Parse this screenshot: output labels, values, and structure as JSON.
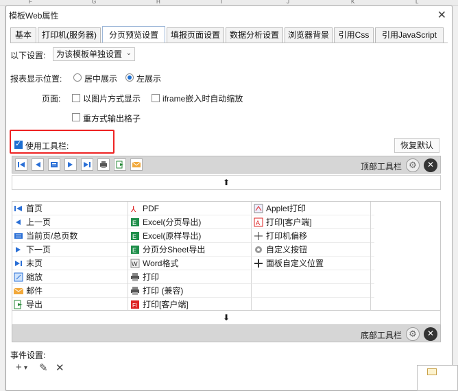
{
  "background": {
    "columns": [
      "F",
      "G",
      "H",
      "I",
      "J",
      "K",
      "L"
    ]
  },
  "dialog": {
    "title": "模板Web属性",
    "close_glyph": "✕"
  },
  "tabs": [
    {
      "label": "基本"
    },
    {
      "label": "打印机(服务器)"
    },
    {
      "label": "分页预览设置",
      "active": true
    },
    {
      "label": "填报页面设置"
    },
    {
      "label": "数据分析设置"
    },
    {
      "label": "浏览器背景"
    },
    {
      "label": "引用Css"
    },
    {
      "label": "引用JavaScript"
    }
  ],
  "settings": {
    "scope_label": "以下设置:",
    "scope_value": "为该模板单独设置",
    "position_label": "报表显示位置:",
    "position_center": "居中展示",
    "position_left": "左展示",
    "position_selected": "left",
    "page_label": "页面:",
    "option_image": "以图片方式显示",
    "option_iframe": "iframe嵌入时自动缩放",
    "option_repeat": "重方式输出格子",
    "use_toolbar_label": "使用工具栏:",
    "use_toolbar_checked": true,
    "restore_default": "恢复默认"
  },
  "toolbars": {
    "top_label": "顶部工具栏",
    "bottom_label": "底部工具栏",
    "up_arrow": "⬆",
    "down_arrow": "⬇",
    "top_icons": [
      "first-page-icon",
      "prev-page-icon",
      "page-count-icon",
      "next-page-icon",
      "last-page-icon",
      "print-icon",
      "export-icon",
      "email-icon"
    ]
  },
  "available_buttons": {
    "col1": [
      {
        "label": "首页",
        "icon": "first-page-icon"
      },
      {
        "label": "上一页",
        "icon": "prev-page-icon"
      },
      {
        "label": "当前页/总页数",
        "icon": "page-count-icon"
      },
      {
        "label": "下一页",
        "icon": "next-page-icon"
      },
      {
        "label": "末页",
        "icon": "last-page-icon"
      },
      {
        "label": "缩放",
        "icon": "zoom-icon"
      },
      {
        "label": "邮件",
        "icon": "email-icon"
      },
      {
        "label": "导出",
        "icon": "export-icon"
      }
    ],
    "col2": [
      {
        "label": "PDF",
        "icon": "pdf-icon"
      },
      {
        "label": "Excel(分页导出)",
        "icon": "excel-icon"
      },
      {
        "label": "Excel(原样导出)",
        "icon": "excel-icon"
      },
      {
        "label": "分页分Sheet导出",
        "icon": "excel-icon"
      },
      {
        "label": "Word格式",
        "icon": "word-icon"
      },
      {
        "label": "打印",
        "icon": "print-icon"
      },
      {
        "label": "打印 (兼容)",
        "icon": "print-icon"
      },
      {
        "label": "打印[客户端]",
        "icon": "flash-print-icon"
      }
    ],
    "col3": [
      {
        "label": "Applet打印",
        "icon": "applet-print-icon"
      },
      {
        "label": "打印[客户端]",
        "icon": "pdf-print-icon"
      },
      {
        "label": "打印机偏移",
        "icon": "move-icon"
      },
      {
        "label": "自定义按钮",
        "icon": "gear-icon"
      },
      {
        "label": "面板自定义位置",
        "icon": "move-icon"
      }
    ]
  },
  "events": {
    "label": "事件设置:",
    "add": "+",
    "add_dropdown": "▾",
    "edit": "✎",
    "delete": "✕"
  },
  "colors": {
    "accent": "#1d6fd1",
    "highlight": "#ee2222",
    "toolbar_bg": "#d6d6d6"
  }
}
